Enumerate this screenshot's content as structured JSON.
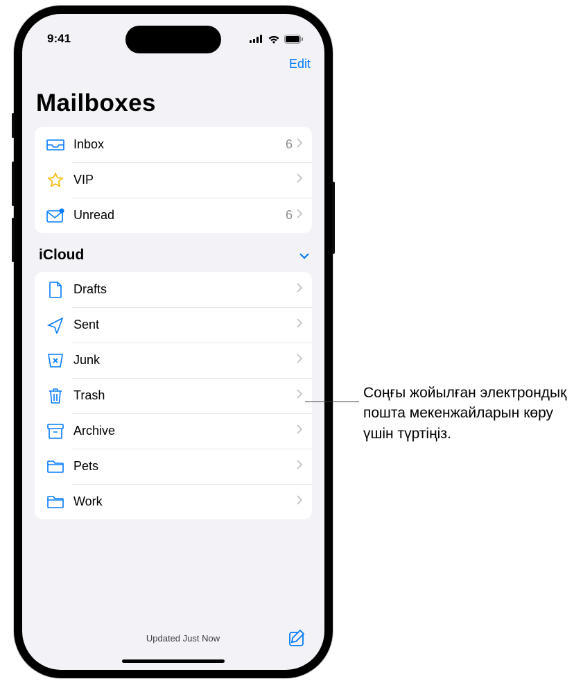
{
  "status": {
    "time": "9:41"
  },
  "nav": {
    "edit": "Edit"
  },
  "title": "Mailboxes",
  "group_main": [
    {
      "icon": "inbox",
      "label": "Inbox",
      "count": "6"
    },
    {
      "icon": "star",
      "label": "VIP",
      "count": ""
    },
    {
      "icon": "unread",
      "label": "Unread",
      "count": "6"
    }
  ],
  "section": {
    "label": "iCloud"
  },
  "group_icloud": [
    {
      "icon": "drafts",
      "label": "Drafts"
    },
    {
      "icon": "sent",
      "label": "Sent"
    },
    {
      "icon": "junk",
      "label": "Junk"
    },
    {
      "icon": "trash",
      "label": "Trash"
    },
    {
      "icon": "archive",
      "label": "Archive"
    },
    {
      "icon": "folder",
      "label": "Pets"
    },
    {
      "icon": "folder",
      "label": "Work"
    }
  ],
  "toolbar": {
    "status": "Updated Just Now"
  },
  "callout": {
    "text": "Соңғы жойылған электрондық пошта мекенжайларын көру үшін түртіңіз."
  }
}
